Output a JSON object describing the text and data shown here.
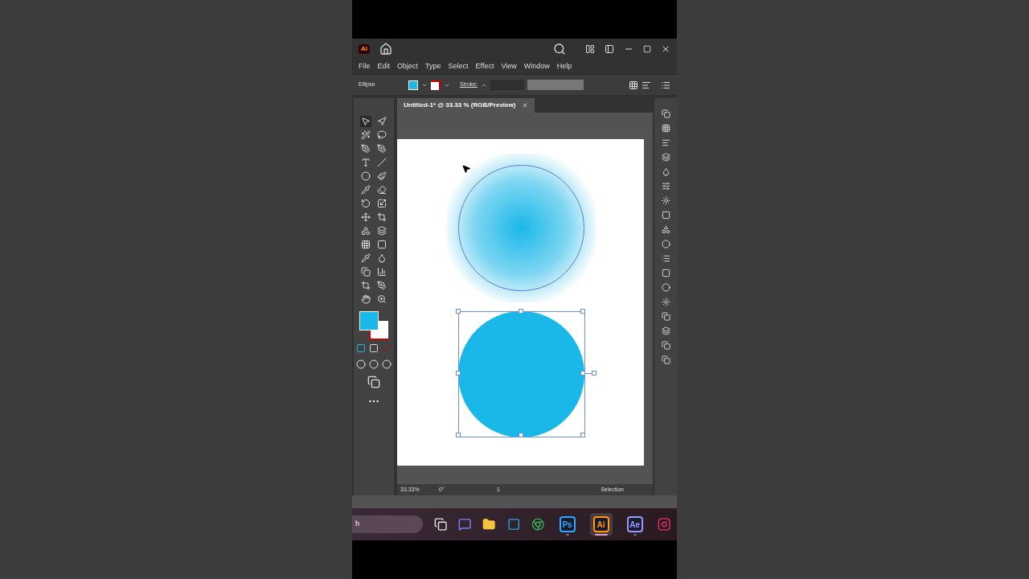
{
  "app_logo": "Ai",
  "menu": [
    "File",
    "Edit",
    "Object",
    "Type",
    "Select",
    "Effect",
    "View",
    "Window",
    "Help"
  ],
  "control_bar": {
    "selection_label": "Ellipse",
    "stroke_label": "Stroke:"
  },
  "tabs": [
    {
      "label": "Untitled-1* @ 33.33 % (RGB/Preview)",
      "selected": true
    }
  ],
  "canvas": {
    "objects": [
      {
        "kind": "gradient-circle",
        "selected": false
      },
      {
        "kind": "solid-circle",
        "selected": true
      }
    ]
  },
  "status_bar": {
    "zoom": "33.33%",
    "rotation": "0°",
    "artboard": "1",
    "tool": "Selection"
  },
  "taskbar": {
    "search_text": "h",
    "apps": [
      {
        "kind": "task-view"
      },
      {
        "kind": "chat"
      },
      {
        "kind": "folder"
      },
      {
        "kind": "app"
      },
      {
        "kind": "browser"
      },
      {
        "kind": "badge",
        "label": "Ps",
        "color": "#31a8ff",
        "selected": false
      },
      {
        "kind": "badge",
        "label": "Ai",
        "color": "#ff9a00",
        "selected": true
      },
      {
        "kind": "badge",
        "label": "Ae",
        "color": "#9999ff",
        "selected": false
      },
      {
        "kind": "camera"
      }
    ]
  }
}
